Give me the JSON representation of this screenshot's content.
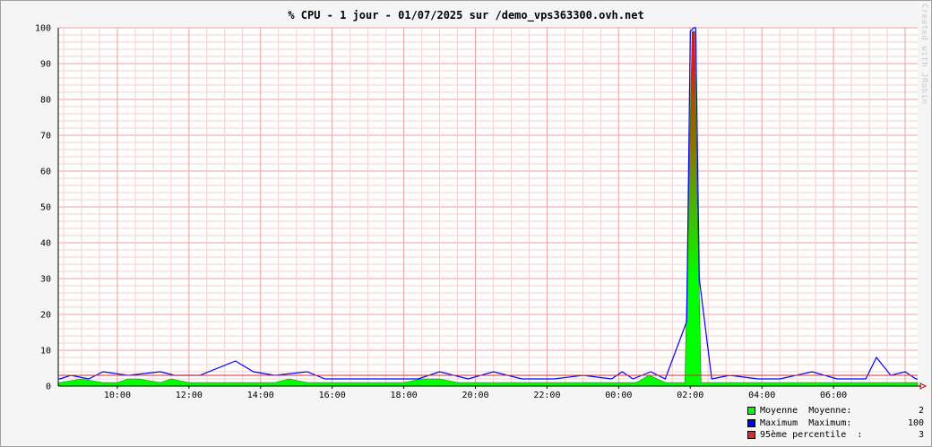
{
  "title": "% CPU - 1 jour - 01/07/2025 sur /demo_vps363300.ovh.net",
  "watermark": "Created with JRobin",
  "colors": {
    "background": "#f5f5f5",
    "plot_background": "#ffffff",
    "major_grid": "#e8a0a0",
    "minor_grid": "#f0d0d0",
    "moyenne": "#00ff00",
    "maximum": "#0000ff",
    "percentile": "#cc3333",
    "spike_top": "#ff0000"
  },
  "legend": [
    {
      "label": "Moyenne",
      "stat": "Moyenne:",
      "value": "2",
      "color": "#00ff00"
    },
    {
      "label": "Maximum",
      "stat": "Maximum:",
      "value": "100",
      "color": "#0000ff"
    },
    {
      "label": "95ème percentile",
      "stat": ":",
      "value": "3",
      "color": "#cc3333"
    }
  ],
  "chart_data": {
    "type": "area",
    "title": "% CPU - 1 jour - 01/07/2025 sur /demo_vps363300.ovh.net",
    "xlabel": "",
    "ylabel": "",
    "ylim": [
      0,
      100
    ],
    "y_ticks": [
      0,
      10,
      20,
      30,
      40,
      50,
      60,
      70,
      80,
      90,
      100
    ],
    "x_ticks": [
      "10:00",
      "12:00",
      "14:00",
      "16:00",
      "18:00",
      "20:00",
      "22:00",
      "00:00",
      "02:00",
      "04:00",
      "06:00"
    ],
    "xlim_hours": [
      8.35,
      8.35
    ],
    "grid": true,
    "legend_position": "bottom-right",
    "percentile_95": 3,
    "series": [
      {
        "name": "Moyenne",
        "x_hours": [
          8.4,
          9.0,
          9.6,
          10.0,
          10.3,
          10.6,
          11.2,
          11.5,
          12.0,
          12.5,
          13.0,
          13.5,
          14.0,
          14.4,
          14.8,
          15.3,
          15.8,
          16.3,
          17.0,
          17.5,
          18.0,
          18.5,
          19.0,
          19.5,
          20.0,
          20.5,
          21.0,
          21.5,
          22.0,
          22.5,
          23.0,
          23.5,
          0.0,
          0.5,
          0.85,
          1.3,
          1.85,
          1.95,
          2.05,
          2.12,
          2.2,
          2.3,
          2.6,
          3.0,
          3.5,
          4.0,
          4.5,
          5.0,
          5.5,
          6.0,
          6.5,
          7.0,
          7.5,
          8.0,
          8.3
        ],
        "values": [
          1,
          2,
          1,
          1,
          2,
          2,
          1,
          2,
          1,
          1,
          1,
          1,
          1,
          1,
          2,
          1,
          1,
          1,
          1,
          1,
          1,
          2,
          2,
          1,
          1,
          1,
          1,
          1,
          1,
          1,
          1,
          1,
          1,
          1,
          3,
          1,
          1,
          50,
          99,
          99,
          50,
          1,
          1,
          1,
          1,
          1,
          1,
          1,
          1,
          1,
          1,
          1,
          1,
          1,
          1
        ]
      },
      {
        "name": "Maximum",
        "x_hours": [
          8.4,
          8.7,
          9.2,
          9.6,
          10.3,
          11.2,
          11.6,
          12.3,
          13.3,
          13.8,
          14.4,
          15.3,
          15.8,
          16.5,
          17.5,
          18.4,
          19.0,
          19.8,
          20.5,
          21.3,
          22.2,
          23.0,
          23.8,
          0.1,
          0.4,
          0.9,
          1.3,
          1.9,
          2.0,
          2.1,
          2.15,
          2.25,
          2.6,
          3.1,
          3.9,
          4.5,
          5.4,
          6.1,
          6.9,
          7.2,
          7.6,
          8.0,
          8.3
        ],
        "values": [
          2,
          3,
          2,
          4,
          3,
          4,
          3,
          3,
          7,
          4,
          3,
          4,
          2,
          2,
          2,
          2,
          4,
          2,
          4,
          2,
          2,
          3,
          2,
          4,
          2,
          4,
          2,
          18,
          99,
          100,
          100,
          30,
          2,
          3,
          2,
          2,
          4,
          2,
          2,
          8,
          3,
          4,
          2
        ]
      }
    ]
  }
}
